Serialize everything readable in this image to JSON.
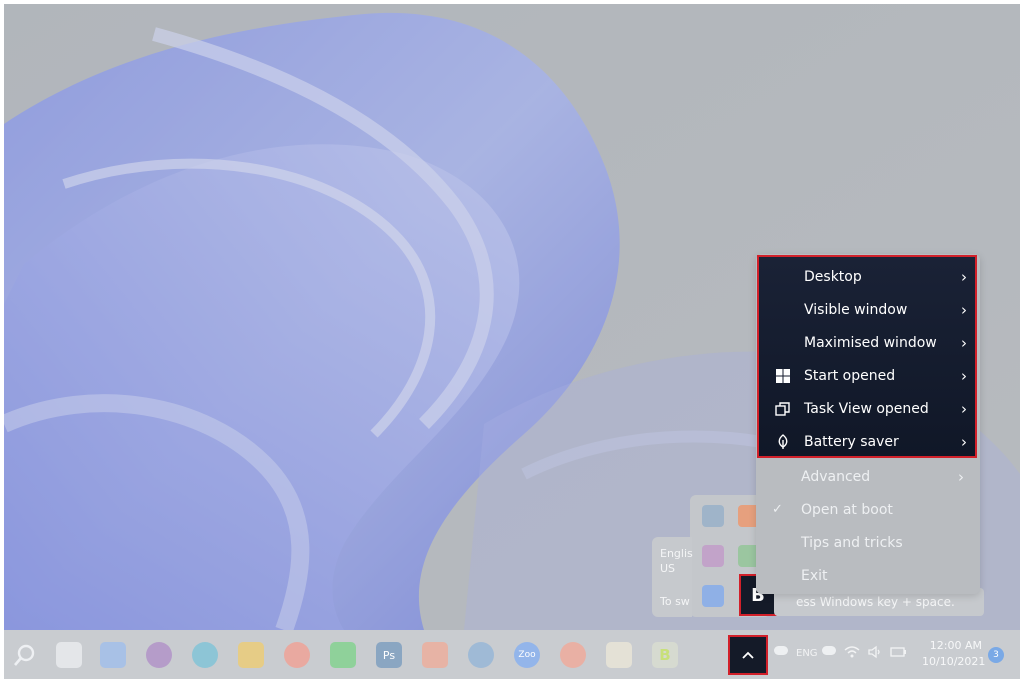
{
  "context_menu": {
    "highlighted_items": [
      {
        "label": "Desktop",
        "icon": "",
        "chevron": "›"
      },
      {
        "label": "Visible window",
        "icon": "",
        "chevron": "›"
      },
      {
        "label": "Maximised window",
        "icon": "",
        "chevron": "›"
      },
      {
        "label": "Start opened",
        "icon": "windows-logo-icon",
        "chevron": "›"
      },
      {
        "label": "Task View opened",
        "icon": "task-view-icon",
        "chevron": "›"
      },
      {
        "label": "Battery saver",
        "icon": "battery-saver-leaf-icon",
        "chevron": "›"
      }
    ],
    "other_items": [
      {
        "label": "Advanced",
        "icon": "",
        "chevron": "›"
      },
      {
        "label": "Open at boot",
        "icon": "checkmark-icon",
        "chevron": ""
      },
      {
        "label": "Tips and tricks",
        "icon": "",
        "chevron": ""
      },
      {
        "label": "Exit",
        "icon": "",
        "chevron": ""
      }
    ],
    "highlight_color": "#d2202a"
  },
  "language_popup": {
    "line1": "Englis",
    "line2": "US",
    "line3": "To sw"
  },
  "hint_text": "ess Windows key + space.",
  "tray_overflow": {
    "selected_app_glyph": "B"
  },
  "taskbar": {
    "show_hidden_chevron": "^",
    "language": "ENG",
    "time": "12:00 AM",
    "date": "10/10/2021",
    "notifications": "3",
    "ps_label": "Ps",
    "zoom_label": "Zoo"
  }
}
